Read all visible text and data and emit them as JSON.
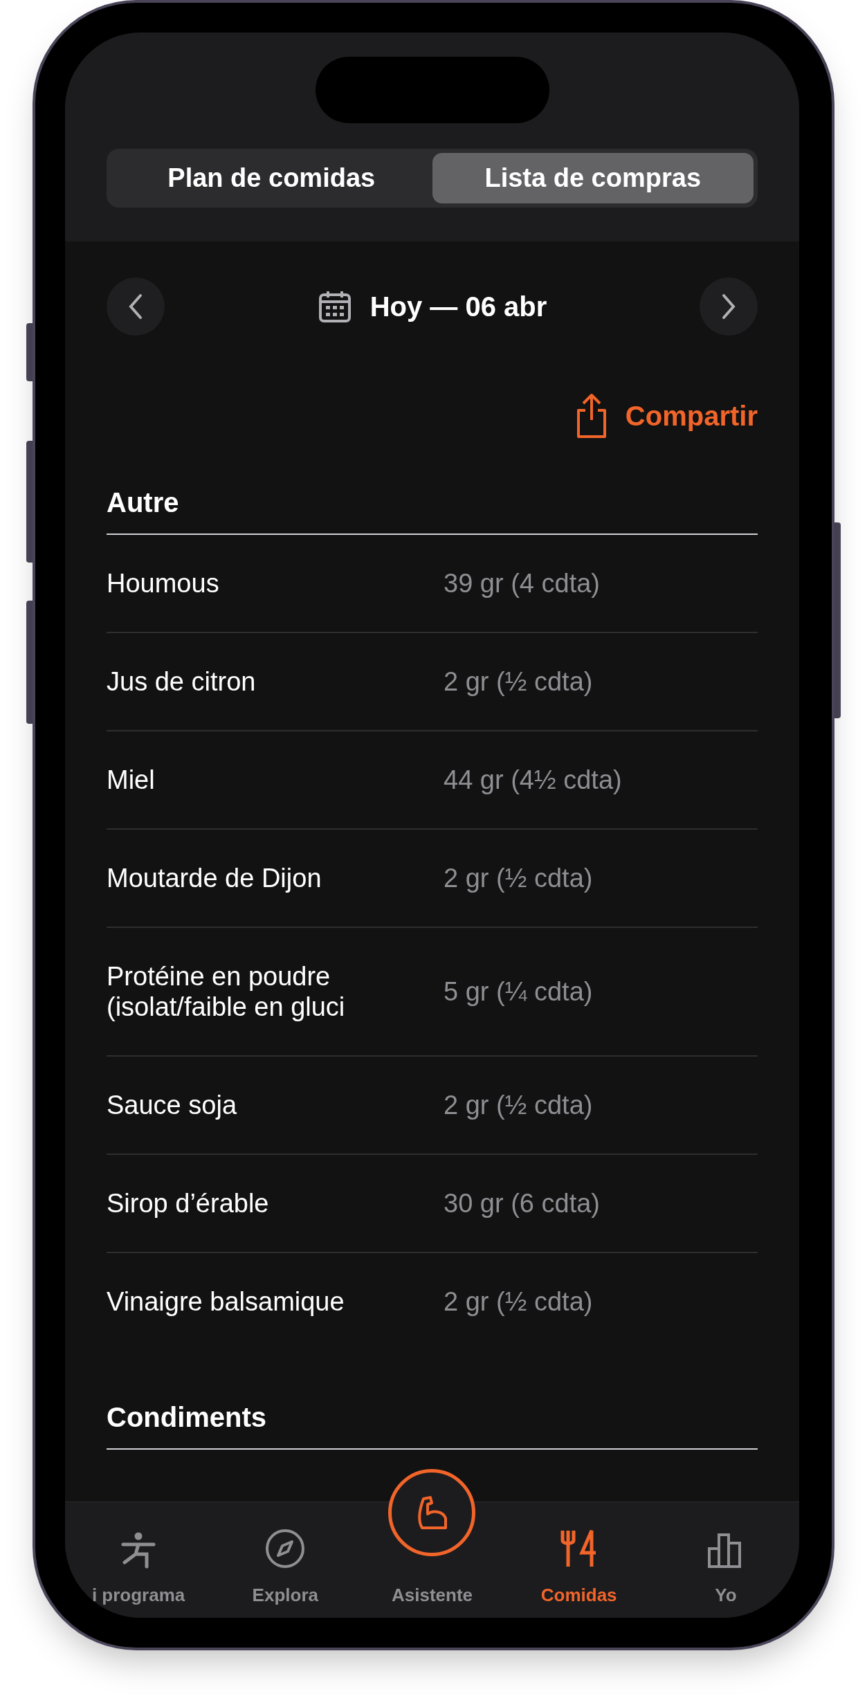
{
  "segmented": [
    {
      "label": "Plan de comidas",
      "selected": false
    },
    {
      "label": "Lista de compras",
      "selected": true
    }
  ],
  "date_nav": {
    "label": "Hoy — 06 abr"
  },
  "share": {
    "label": "Compartir"
  },
  "sections": [
    {
      "title": "Autre",
      "items": [
        {
          "name": "Houmous",
          "amount": "39 gr (4 cdta)"
        },
        {
          "name": "Jus de citron",
          "amount": "2 gr (½ cdta)"
        },
        {
          "name": "Miel",
          "amount": "44 gr (4½ cdta)"
        },
        {
          "name": "Moutarde de Dijon",
          "amount": "2 gr (½ cdta)"
        },
        {
          "name": "Protéine en poudre (isolat/faible en gluci",
          "amount": "5 gr (¼ cdta)"
        },
        {
          "name": "Sauce soja",
          "amount": "2 gr (½ cdta)"
        },
        {
          "name": "Sirop d’érable",
          "amount": "30 gr (6 cdta)"
        },
        {
          "name": "Vinaigre balsamique",
          "amount": "2 gr (½ cdta)"
        }
      ]
    },
    {
      "title": "Condiments"
    }
  ],
  "tab_bar": [
    {
      "label": "i programa",
      "selected": false,
      "kind": "tab"
    },
    {
      "label": "Explora",
      "selected": false,
      "kind": "tab"
    },
    {
      "label": "Asistente",
      "selected": false,
      "kind": "center"
    },
    {
      "label": "Comidas",
      "selected": true,
      "kind": "tab"
    },
    {
      "label": "Yo",
      "selected": false,
      "kind": "tab"
    }
  ]
}
